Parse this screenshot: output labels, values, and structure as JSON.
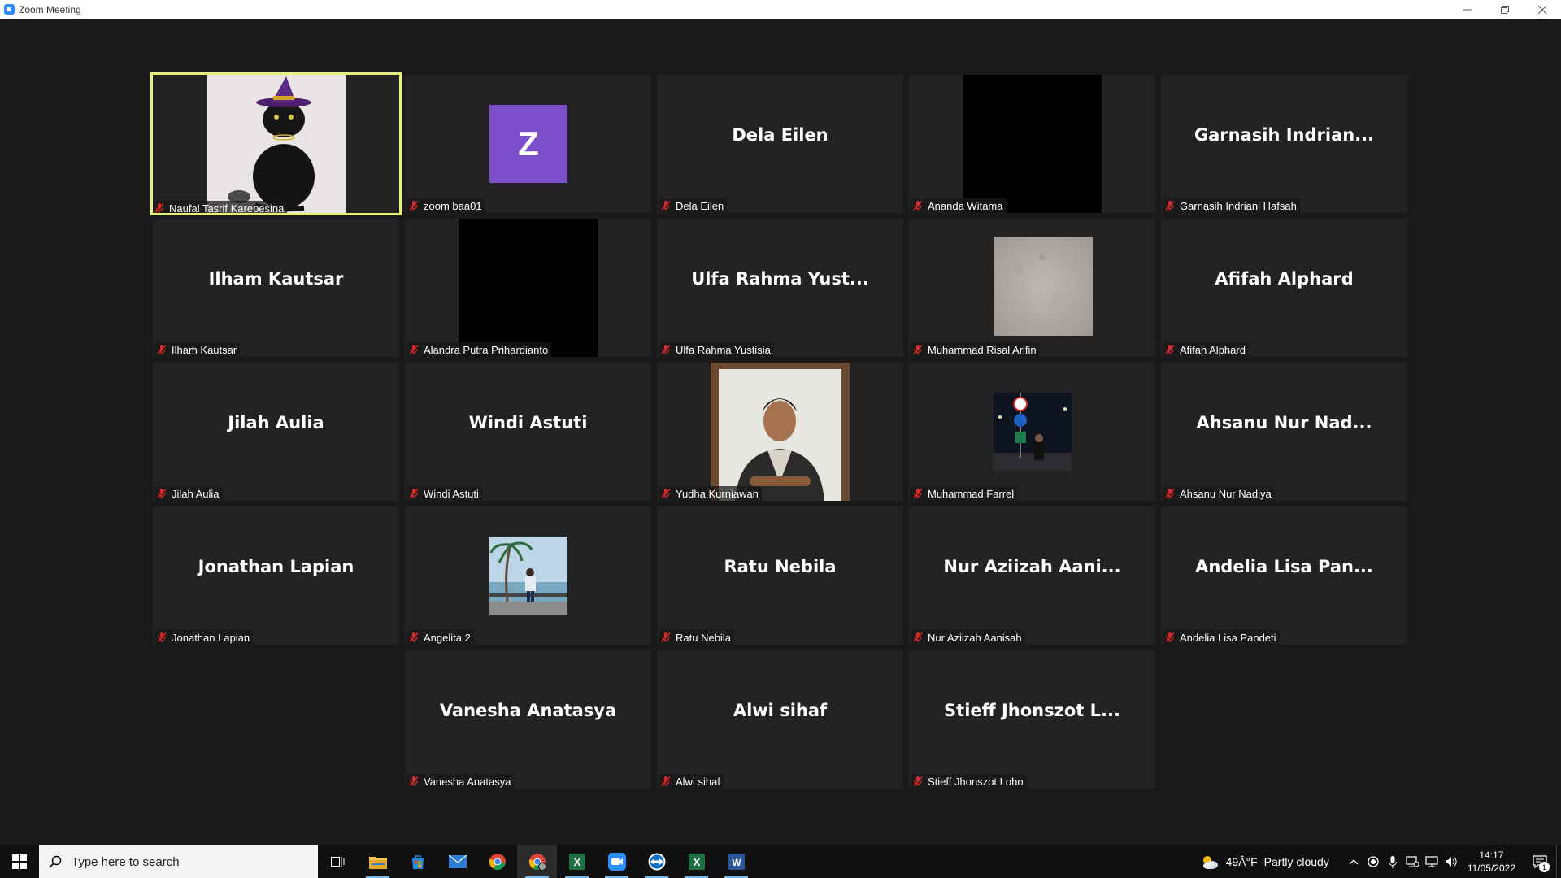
{
  "window": {
    "title": "Zoom Meeting"
  },
  "participants": [
    {
      "big": "",
      "tag": "Naufal Tasrif Karepesina",
      "kind": "cat"
    },
    {
      "big": "",
      "tag": "zoom baa01",
      "kind": "avatar",
      "avatar_letter": "Z"
    },
    {
      "big": "Dela Eilen",
      "tag": "Dela Eilen",
      "kind": "name"
    },
    {
      "big": "",
      "tag": "Ananda Witama",
      "kind": "black"
    },
    {
      "big": "Garnasih  Indrian...",
      "tag": "Garnasih Indriani Hafsah",
      "kind": "name"
    },
    {
      "big": "Ilham Kautsar",
      "tag": "Ilham Kautsar",
      "kind": "name"
    },
    {
      "big": "",
      "tag": "Alandra Putra Prihardianto",
      "kind": "black"
    },
    {
      "big": "Ulfa Rahma Yust...",
      "tag": "Ulfa Rahma Yustisia",
      "kind": "name"
    },
    {
      "big": "",
      "tag": "Muhammad Risal Arifin",
      "kind": "texture"
    },
    {
      "big": "Afifah Alphard",
      "tag": "Afifah Alphard",
      "kind": "name"
    },
    {
      "big": "Jilah Aulia",
      "tag": "Jilah Aulia",
      "kind": "name"
    },
    {
      "big": "Windi Astuti",
      "tag": "Windi Astuti",
      "kind": "name"
    },
    {
      "big": "",
      "tag": "Yudha Kurniawan",
      "kind": "person"
    },
    {
      "big": "",
      "tag": "Muhammad Farrel",
      "kind": "night"
    },
    {
      "big": "Ahsanu Nur Nad...",
      "tag": "Ahsanu Nur Nadiya",
      "kind": "name"
    },
    {
      "big": "Jonathan Lapian",
      "tag": "Jonathan Lapian",
      "kind": "name"
    },
    {
      "big": "",
      "tag": "Angelita 2",
      "kind": "beach"
    },
    {
      "big": "Ratu Nebila",
      "tag": "Ratu Nebila",
      "kind": "name"
    },
    {
      "big": "Nur Aziizah Aani...",
      "tag": "Nur Aziizah Aanisah",
      "kind": "name"
    },
    {
      "big": "Andelia Lisa Pan...",
      "tag": "Andelia Lisa Pandeti",
      "kind": "name"
    },
    {
      "big": "Vanesha Anatasya",
      "tag": "Vanesha Anatasya",
      "kind": "name"
    },
    {
      "big": "Alwi sihaf",
      "tag": "Alwi sihaf",
      "kind": "name"
    },
    {
      "big": "Stieff  Jhonszot  L...",
      "tag": "Stieff Jhonszot Loho",
      "kind": "name"
    }
  ],
  "taskbar": {
    "search_placeholder": "Type here to search",
    "apps": [
      "task-view",
      "file-explorer",
      "microsoft-store",
      "mail",
      "chrome",
      "chrome-profile",
      "excel",
      "zoom",
      "teamviewer",
      "excel",
      "word"
    ],
    "weather_temp": "49Â°F",
    "weather_desc": "Partly cloudy",
    "time": "14:17",
    "date": "11/05/2022",
    "notification_count": "1"
  },
  "colors": {
    "active_speaker_border": "#e8f07a",
    "avatar_bg": "#7b4fc9",
    "mute_red": "#e02828"
  }
}
